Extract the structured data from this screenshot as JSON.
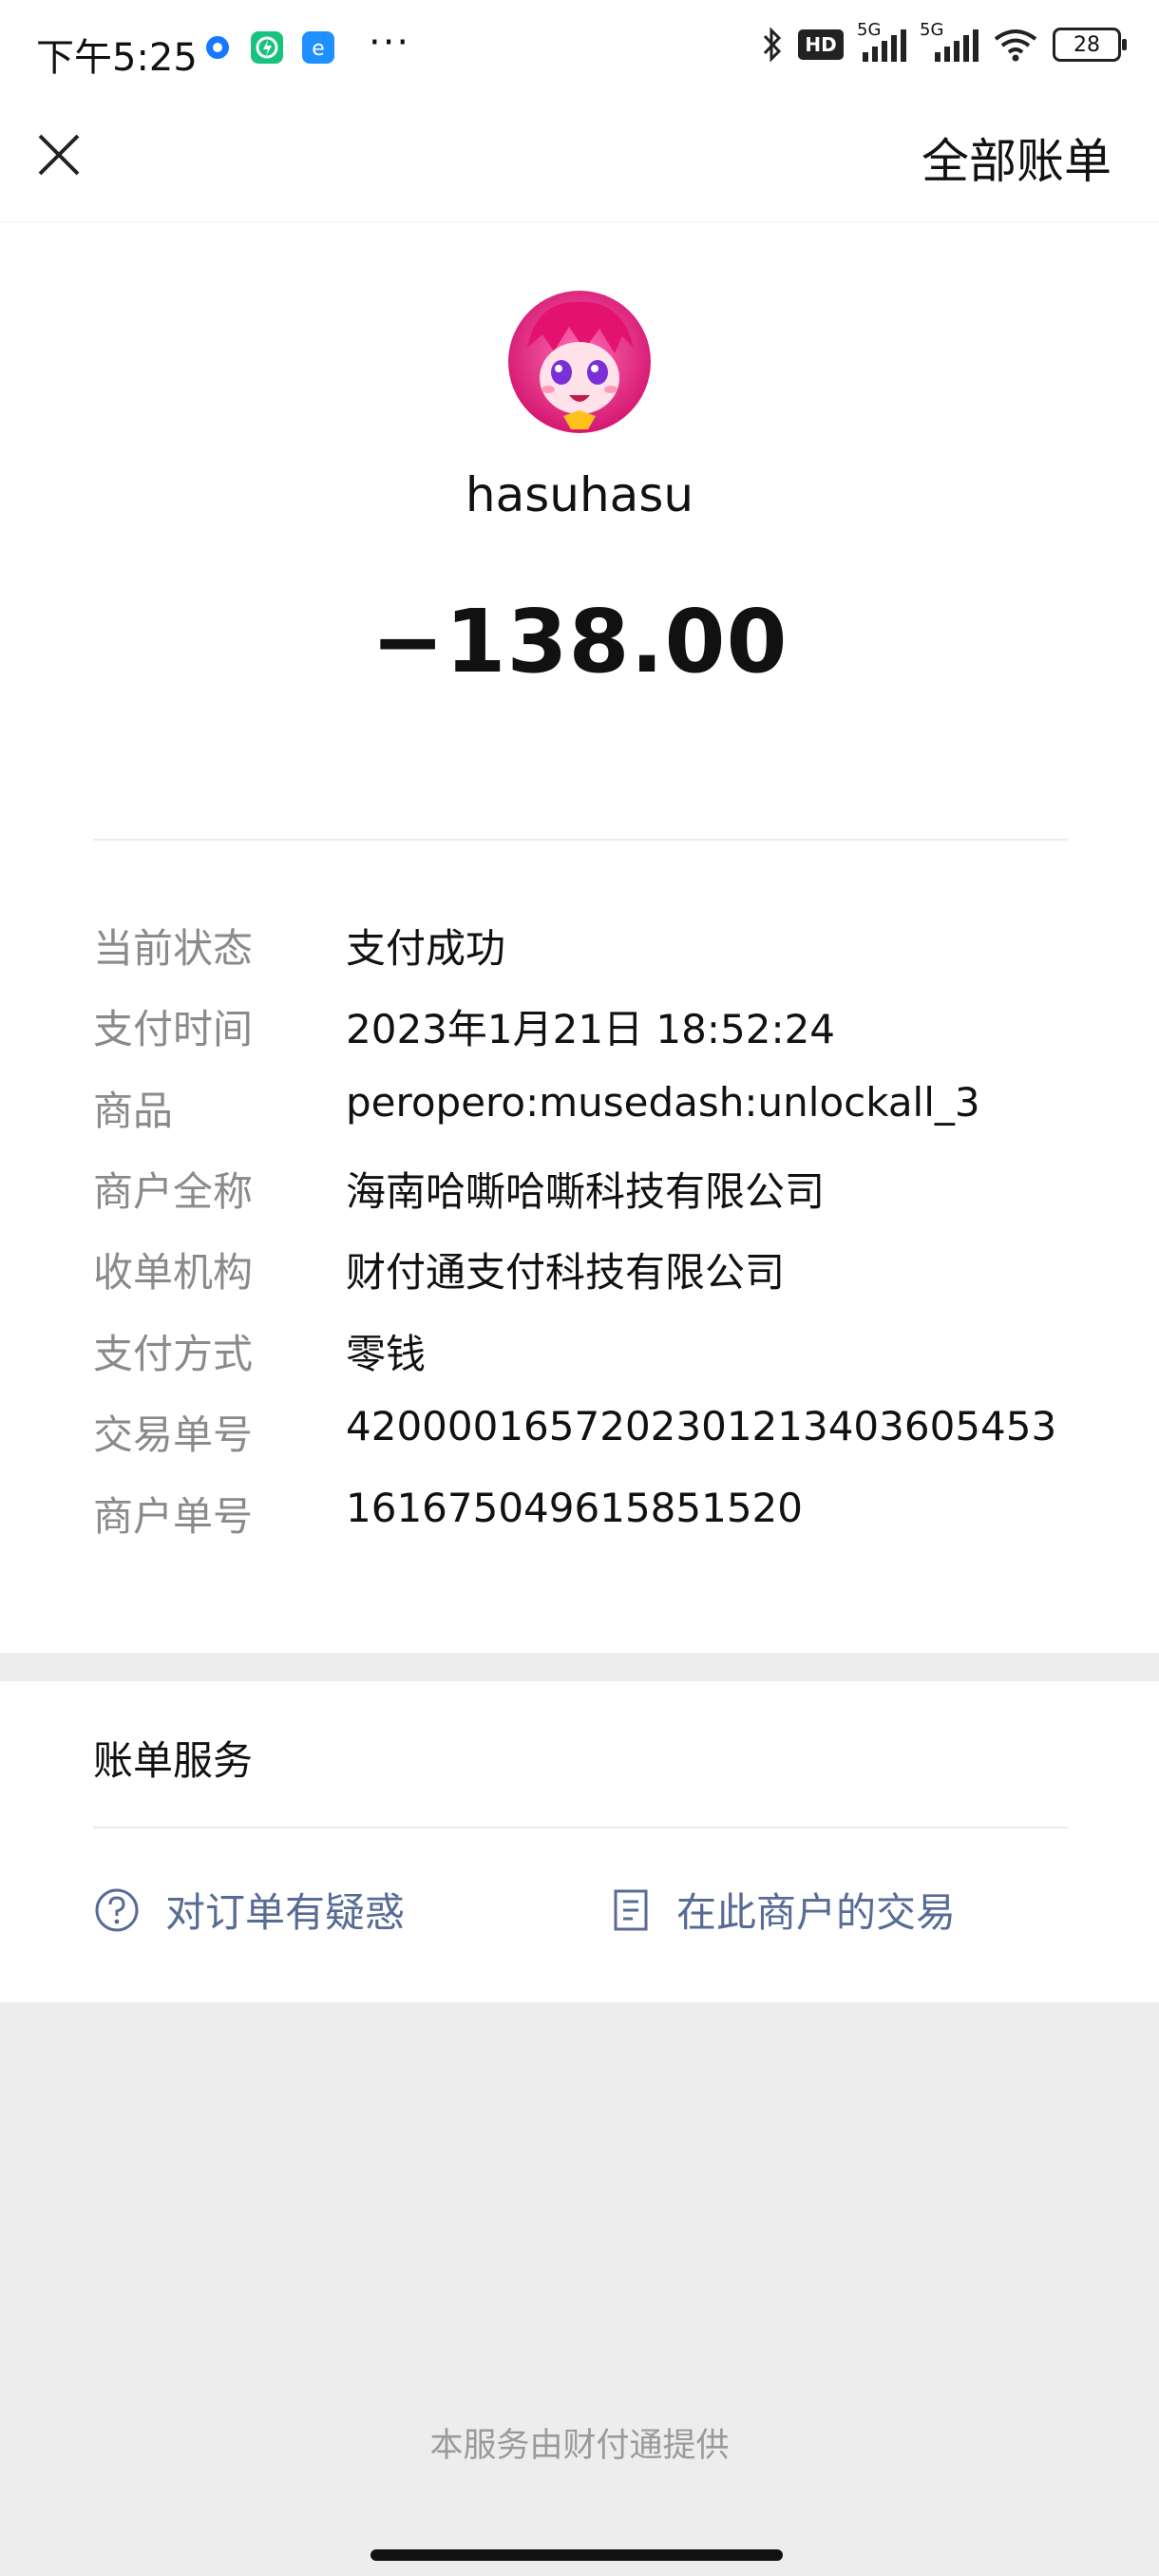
{
  "status_bar": {
    "time": "下午5:25",
    "dots": "···",
    "network1": "5G",
    "network2": "5G",
    "hd_badge": "HD",
    "battery": "28"
  },
  "nav": {
    "right_link": "全部账单"
  },
  "transaction": {
    "merchant_name": "hasuhasu",
    "amount": "−138.00"
  },
  "details": [
    {
      "label": "当前状态",
      "value": "支付成功"
    },
    {
      "label": "支付时间",
      "value": "2023年1月21日 18:52:24"
    },
    {
      "label": "商品",
      "value": "peropero:musedash:unlockall_3"
    },
    {
      "label": "商户全称",
      "value": "海南哈嘶哈嘶科技有限公司"
    },
    {
      "label": "收单机构",
      "value": "财付通支付科技有限公司"
    },
    {
      "label": "支付方式",
      "value": "零钱"
    },
    {
      "label": "交易单号",
      "value": "4200001657202301213403605453"
    },
    {
      "label": "商户单号",
      "value": "161675049615851520"
    }
  ],
  "service": {
    "title": "账单服务",
    "question_link": "对订单有疑惑",
    "merchant_trades_link": "在此商户的交易"
  },
  "footer": "本服务由财付通提供",
  "colors": {
    "link": "#576b95",
    "label": "#8a8a8a",
    "page_bg": "#ededed"
  }
}
